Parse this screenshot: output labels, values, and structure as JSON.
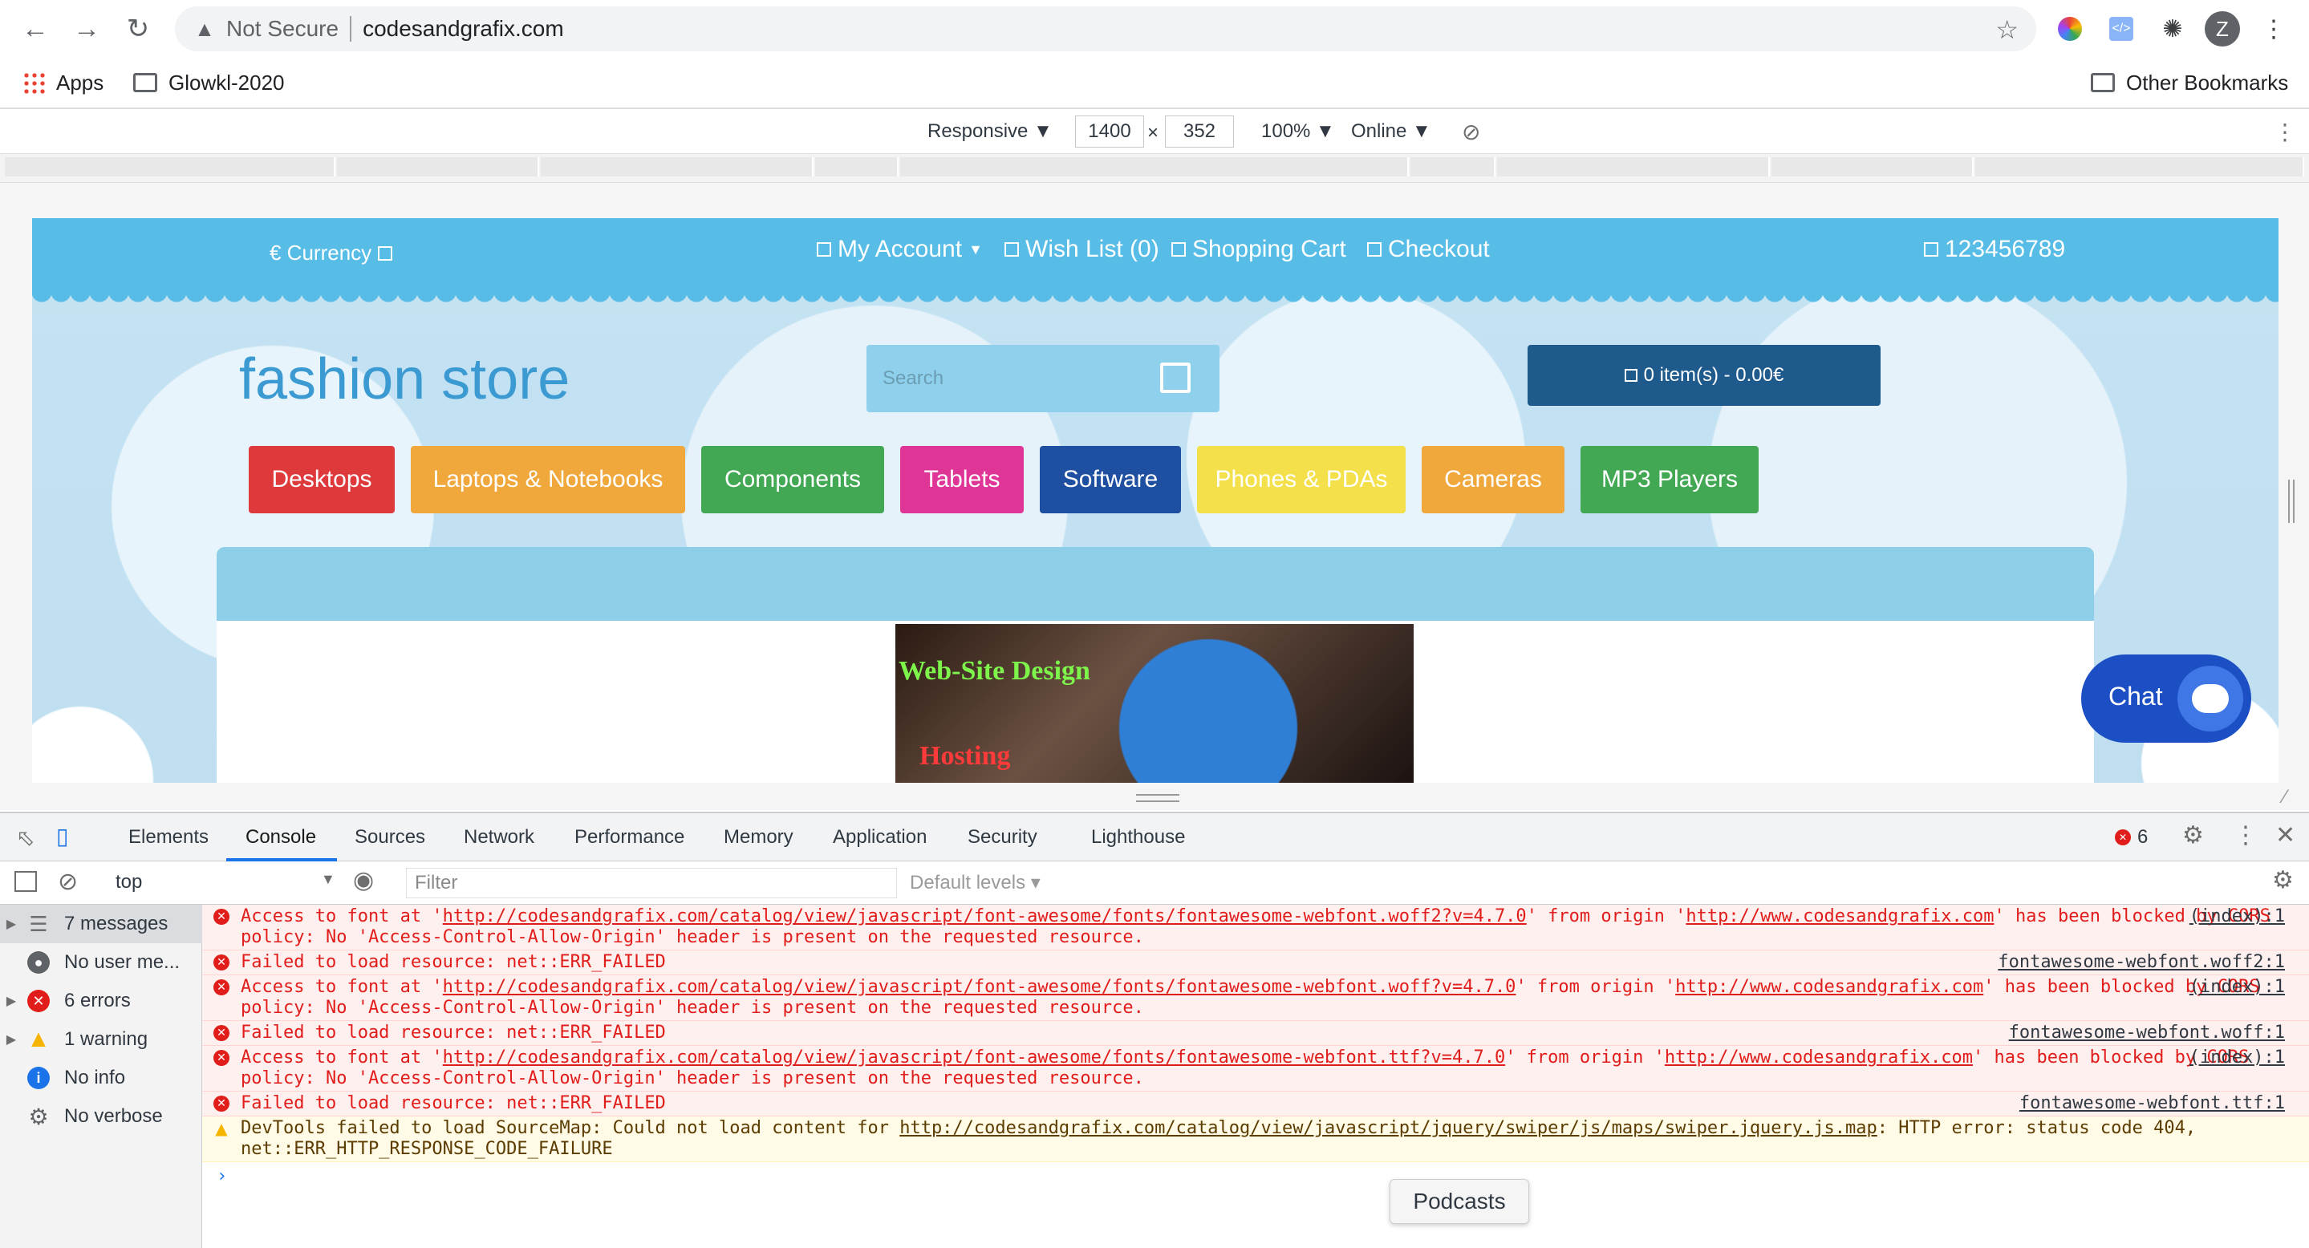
{
  "browser": {
    "security_label": "Not Secure",
    "url": "codesandgrafix.com",
    "avatar_initial": "Z",
    "bookmarks": {
      "apps": "Apps",
      "folder1": "Glowkl-2020",
      "other": "Other Bookmarks"
    }
  },
  "device_toolbar": {
    "mode": "Responsive ▼",
    "width": "1400",
    "times": "×",
    "height": "352",
    "zoom": "100% ▼",
    "network": "Online ▼"
  },
  "site": {
    "currency": "€ Currency",
    "links": [
      "My Account",
      "Wish List (0)",
      "Shopping Cart",
      "Checkout"
    ],
    "phone": "123456789",
    "logo": "fashion store",
    "search_placeholder": "Search",
    "cart": "0 item(s) - 0.00€",
    "categories": [
      {
        "label": "Desktops",
        "color": "#de3a3c"
      },
      {
        "label": "Laptops & Notebooks",
        "color": "#f0a83c"
      },
      {
        "label": "Components",
        "color": "#43a854"
      },
      {
        "label": "Tablets",
        "color": "#df3597"
      },
      {
        "label": "Software",
        "color": "#1f4fa0"
      },
      {
        "label": "Phones & PDAs",
        "color": "#f3e04b"
      },
      {
        "label": "Cameras",
        "color": "#f0a83c"
      },
      {
        "label": "MP3 Players",
        "color": "#43a854"
      }
    ],
    "banner_text_1": "Web-Site Design",
    "banner_text_2": "Hosting",
    "chat_label": "Chat"
  },
  "devtools": {
    "tabs": [
      "Elements",
      "Console",
      "Sources",
      "Network",
      "Performance",
      "Memory",
      "Application",
      "Security",
      "Lighthouse"
    ],
    "active_tab": "Console",
    "error_count": "6",
    "context": "top",
    "filter_placeholder": "Filter",
    "levels": "Default levels ▾",
    "sidebar": [
      {
        "label": "7 messages",
        "icon": "list-icon"
      },
      {
        "label": "No user me...",
        "icon": "user-icon"
      },
      {
        "label": "6 errors",
        "icon": "error-icon"
      },
      {
        "label": "1 warning",
        "icon": "warning-icon"
      },
      {
        "label": "No info",
        "icon": "info-icon"
      },
      {
        "label": "No verbose",
        "icon": "bug-icon"
      }
    ],
    "messages": [
      {
        "type": "error",
        "text_a": "Access to font at '",
        "link": "http://codesandgrafix.com/catalog/view/javascript/font-awesome/fonts/fontawesome-webfont.woff2?v=4.7.0",
        "text_b": "' from origin '",
        "origin": "http://www.codesandgrafix.com",
        "text_c": "' has been blocked by CORS policy: No 'Access-Control-Allow-Origin' header is present on the requested resource.",
        "source": "(index):1"
      },
      {
        "type": "error",
        "text_a": "Failed to load resource: net::ERR_FAILED",
        "source": "fontawesome-webfont.woff2:1"
      },
      {
        "type": "error",
        "text_a": "Access to font at '",
        "link": "http://codesandgrafix.com/catalog/view/javascript/font-awesome/fonts/fontawesome-webfont.woff?v=4.7.0",
        "text_b": "' from origin '",
        "origin": "http://www.codesandgrafix.com",
        "text_c": "' has been blocked by CORS policy: No 'Access-Control-Allow-Origin' header is present on the requested resource.",
        "source": "(index):1"
      },
      {
        "type": "error",
        "text_a": "Failed to load resource: net::ERR_FAILED",
        "source": "fontawesome-webfont.woff:1"
      },
      {
        "type": "error",
        "text_a": "Access to font at '",
        "link": "http://codesandgrafix.com/catalog/view/javascript/font-awesome/fonts/fontawesome-webfont.ttf?v=4.7.0",
        "text_b": "' from origin '",
        "origin": "http://www.codesandgrafix.com",
        "text_c": "' has been blocked by CORS policy: No 'Access-Control-Allow-Origin' header is present on the requested resource.",
        "source": "(index):1"
      },
      {
        "type": "error",
        "text_a": "Failed to load resource: net::ERR_FAILED",
        "source": "fontawesome-webfont.ttf:1"
      },
      {
        "type": "warning",
        "text_a": "DevTools failed to load SourceMap: Could not load content for ",
        "link": "http://codesandgrafix.com/catalog/view/javascript/jquery/swiper/js/maps/swiper.jquery.js.map",
        "text_b": ": HTTP error: status code 404, net::ERR_HTTP_RESPONSE_CODE_FAILURE",
        "source": ""
      }
    ],
    "prompt": "›"
  },
  "tooltip": "Podcasts"
}
